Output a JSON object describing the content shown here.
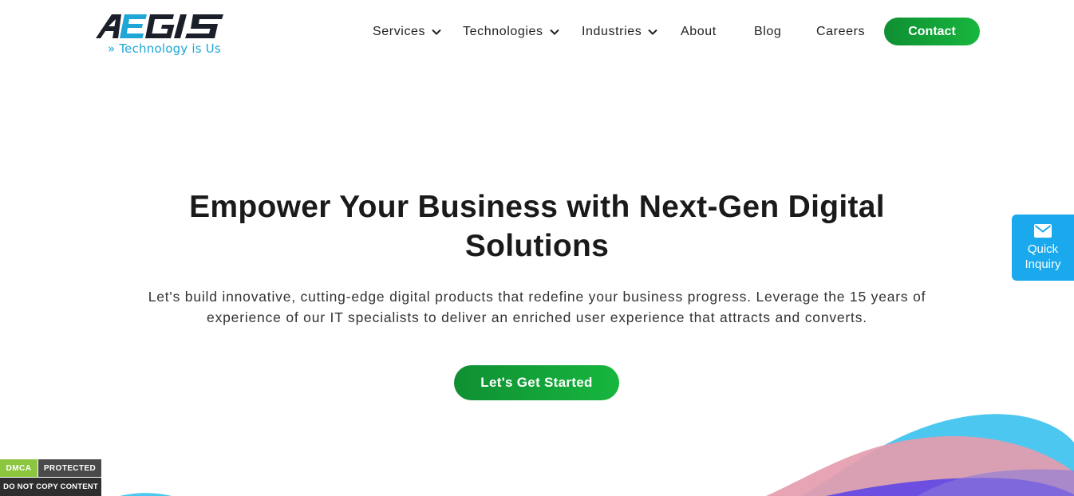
{
  "logo": {
    "wordmark": "AEGIS",
    "tagline": "» Technology is Us",
    "colors": {
      "dark": "#1b1f2a",
      "accent": "#1ea6d6"
    }
  },
  "nav": {
    "items": [
      {
        "label": "Services",
        "has_dropdown": true
      },
      {
        "label": "Technologies",
        "has_dropdown": true
      },
      {
        "label": "Industries",
        "has_dropdown": true
      },
      {
        "label": "About",
        "has_dropdown": false
      },
      {
        "label": "Blog",
        "has_dropdown": false
      },
      {
        "label": "Careers",
        "has_dropdown": false
      }
    ],
    "contact_label": "Contact"
  },
  "hero": {
    "title_line1": "Empower Your Business with Next-Gen Digital",
    "title_line2": "Solutions",
    "subtitle_line1": "Let's build innovative, cutting-edge digital products that redefine your business progress. Leverage the 15 years of",
    "subtitle_line2": "experience of our IT specialists to deliver an enriched user experience that attracts and converts.",
    "cta_label": "Let's Get Started"
  },
  "quick_inquiry": {
    "icon": "envelope-icon",
    "label_line1": "Quick",
    "label_line2": "Inquiry"
  },
  "dmca_badge": {
    "left": "DMCA",
    "right": "PROTECTED",
    "bottom": "DO NOT COPY CONTENT"
  },
  "theme": {
    "green_start": "#0f8f33",
    "green_end": "#17b63e",
    "quick_blue": "#1aa9ec",
    "wave_cyan": "#4cc7ef",
    "wave_pink": "#e59cae",
    "wave_purple": "#6c4fe0"
  }
}
